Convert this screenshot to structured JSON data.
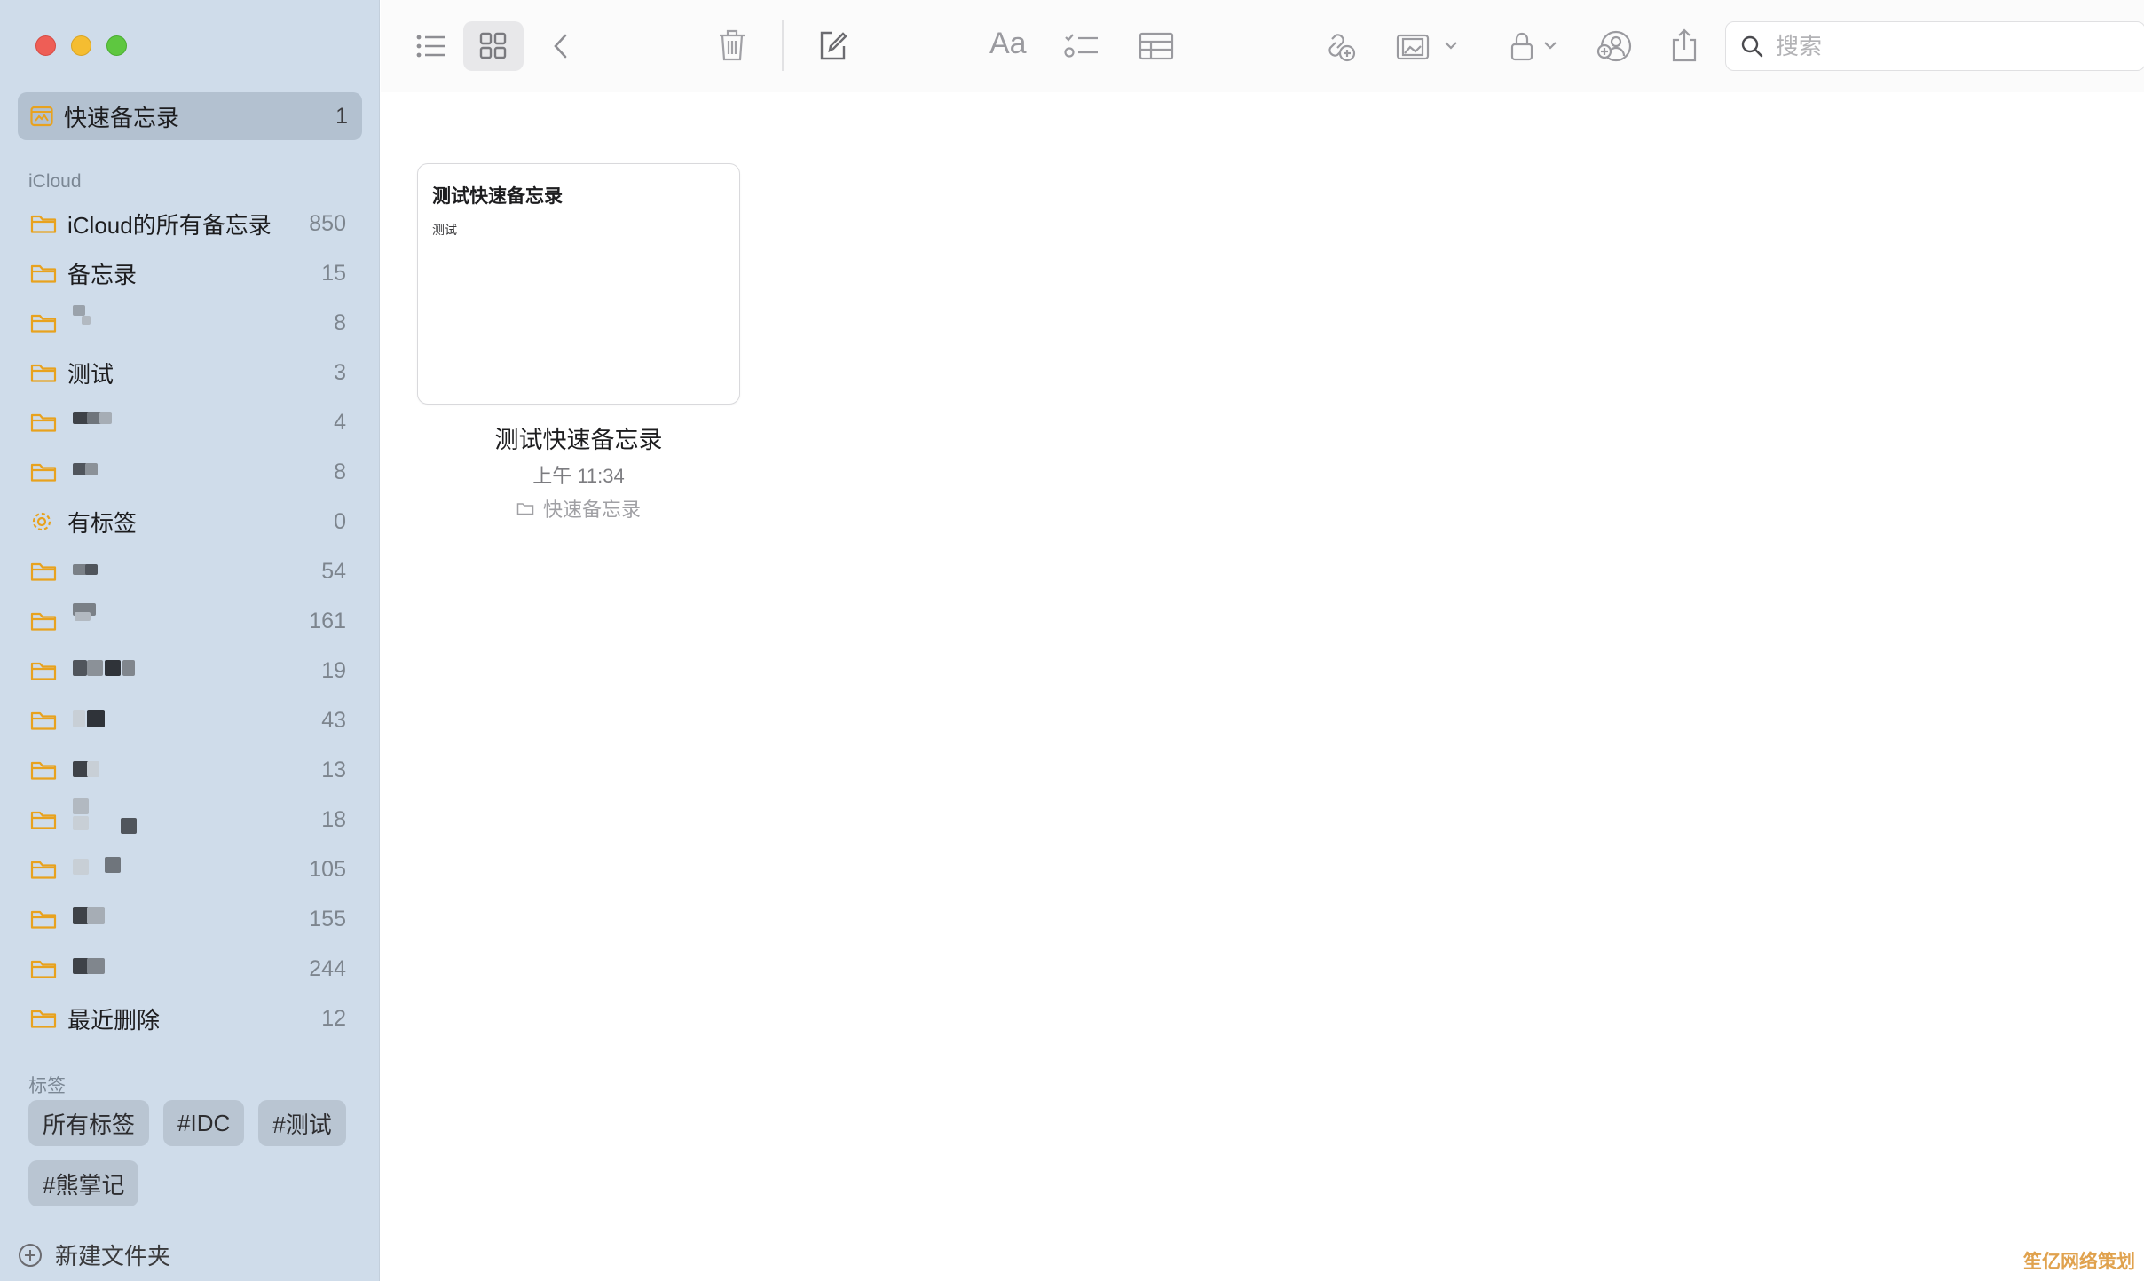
{
  "colors": {
    "accent": "#f0a22a",
    "sidebar_bg": "#cfdcea",
    "selected_bg": "#b3c1d0"
  },
  "sidebar": {
    "quick_note": {
      "label": "快速备忘录",
      "count": "1",
      "icon": "quick-note-icon"
    },
    "icloud_header": "iCloud",
    "folders": [
      {
        "name": "iCloud的所有备忘录",
        "count": "850",
        "icon": "folder-icon"
      },
      {
        "name": "备忘录",
        "count": "15",
        "icon": "folder-icon"
      },
      {
        "name": "",
        "count": "8",
        "icon": "folder-icon",
        "redacted": true
      },
      {
        "name": "测试",
        "count": "3",
        "icon": "folder-icon"
      },
      {
        "name": "",
        "count": "4",
        "icon": "folder-icon",
        "redacted": true
      },
      {
        "name": "",
        "count": "8",
        "icon": "folder-icon",
        "redacted": true
      },
      {
        "name": "有标签",
        "count": "0",
        "icon": "gear-icon"
      },
      {
        "name": "",
        "count": "54",
        "icon": "folder-icon",
        "redacted": true
      },
      {
        "name": "",
        "count": "161",
        "icon": "folder-icon",
        "redacted": true
      },
      {
        "name": "",
        "count": "19",
        "icon": "folder-icon",
        "redacted": true
      },
      {
        "name": "",
        "count": "43",
        "icon": "folder-icon",
        "redacted": true
      },
      {
        "name": "",
        "count": "13",
        "icon": "folder-icon",
        "redacted": true
      },
      {
        "name": "",
        "count": "18",
        "icon": "folder-icon",
        "redacted": true
      },
      {
        "name": "",
        "count": "105",
        "icon": "folder-icon",
        "redacted": true
      },
      {
        "name": "",
        "count": "155",
        "icon": "folder-icon",
        "redacted": true
      },
      {
        "name": "",
        "count": "244",
        "icon": "folder-icon",
        "redacted": true
      },
      {
        "name": "最近删除",
        "count": "12",
        "icon": "folder-icon"
      }
    ],
    "tags_header": "标签",
    "tags": [
      "所有标签",
      "#IDC",
      "#测试",
      "#熊掌记"
    ],
    "new_folder_label": "新建文件夹"
  },
  "toolbar": {
    "icons": [
      "list-view-icon",
      "gallery-view-icon",
      "back-icon",
      "trash-icon",
      "compose-icon",
      "format-icon",
      "checklist-icon",
      "table-icon",
      "collaborate-icon",
      "media-icon",
      "lock-icon",
      "share-people-icon",
      "share-icon"
    ],
    "format_label": "Aa",
    "search_placeholder": "搜索"
  },
  "note": {
    "preview_title": "测试快速备忘录",
    "preview_body": "测试",
    "title": "测试快速备忘录",
    "time": "上午 11:34",
    "folder": "快速备忘录"
  },
  "watermark": "笙亿网络策划"
}
